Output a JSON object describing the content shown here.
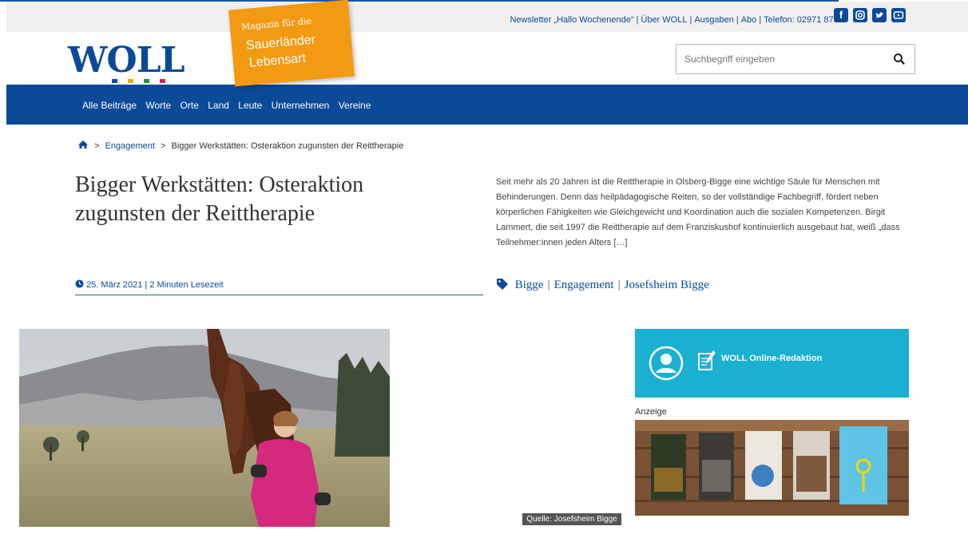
{
  "topbar": {
    "links": [
      "Newsletter „Hallo Wochenende“",
      "Über WOLL",
      "Ausgaben",
      "Abo",
      "Telefon: 02971 87087"
    ],
    "social_icons": [
      "facebook-icon",
      "instagram-icon",
      "twitter-icon",
      "youtube-icon"
    ]
  },
  "header": {
    "logo_text": "WOLL",
    "tagline_line1": "Magazin für die",
    "tagline_line2": "Sauerländer",
    "tagline_line3": "Lebensart",
    "search_placeholder": "Suchbegriff eingeben"
  },
  "nav": {
    "items": [
      "Alle Beiträge",
      "Worte",
      "Orte",
      "Land",
      "Leute",
      "Unternehmen",
      "Vereine"
    ]
  },
  "breadcrumb": {
    "sep": ">",
    "category": "Engagement",
    "current": "Bigger Werkstätten: Osteraktion zugunsten der Reittherapie"
  },
  "article": {
    "title": "Bigger Werkstätten: Osteraktion zugunsten der Reittherapie",
    "excerpt": "Seit mehr als 20 Jahren ist die Reittherapie in Olsberg-Bigge eine wichtige Säule für Menschen mit Behinderungen. Denn das heilpädagogische Reiten, so der vollständige Fachbegriff, fördert neben körperlichen Fähigkeiten wie Gleichgewicht und Koordination auch die sozialen Kompetenzen. Birgit Lammert, die seit 1997 die Reittherapie auf dem Franziskushof kontinuierlich ausgebaut hat, weiß „dass Teilnehmer:innen jeden Alters […]",
    "meta": "25. März 2021 | 2 Minuten Lesezeit",
    "tags": [
      "Bigge",
      "Engagement",
      "Josefsheim Bigge"
    ],
    "tag_sep": "|",
    "image_caption": "Quelle: Josefsheim Bigge"
  },
  "sidebar": {
    "author": "WOLL Online-Redaktion",
    "ad_label": "Anzeige"
  },
  "colors": {
    "brand_blue": "#0b4a99",
    "accent_orange": "#f39a12",
    "author_cyan": "#1ab0d2"
  }
}
